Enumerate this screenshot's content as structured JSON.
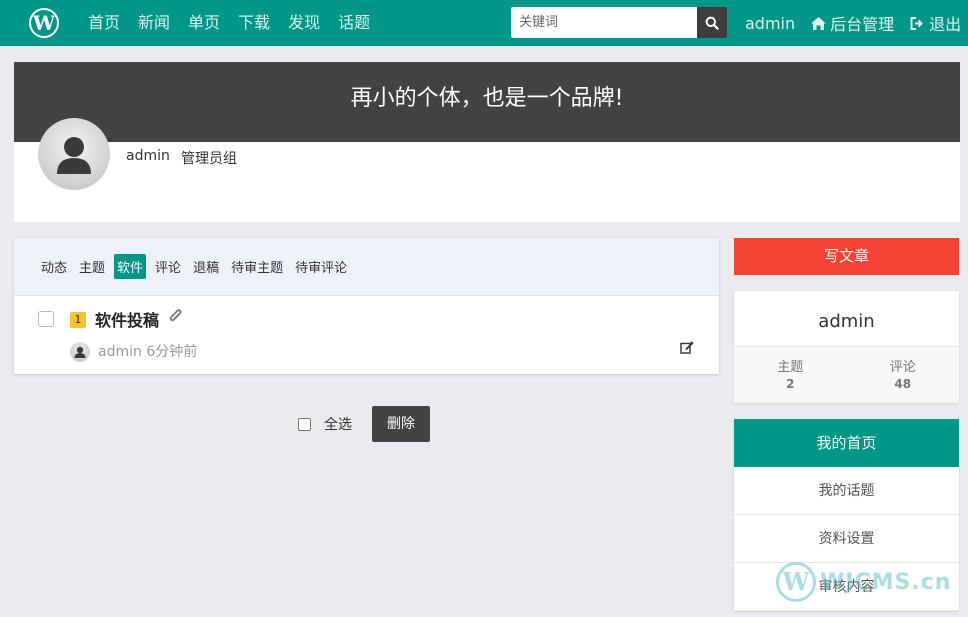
{
  "nav": {
    "logo_letter": "W",
    "links": [
      "首页",
      "新闻",
      "单页",
      "下载",
      "发现",
      "话题"
    ],
    "search_placeholder": "关键词",
    "user": "admin",
    "admin_label": "后台管理",
    "logout_label": "退出"
  },
  "profile": {
    "slogan": "再小的个体，也是一个品牌!",
    "username": "admin",
    "group": "管理员组"
  },
  "tabs": {
    "items": [
      "动态",
      "主题",
      "软件",
      "评论",
      "退稿",
      "待审主题",
      "待审评论"
    ],
    "active": "软件"
  },
  "post": {
    "number": "1",
    "title": "软件投稿",
    "author": "admin",
    "time": "6分钟前"
  },
  "bulk": {
    "select_all": "全选",
    "delete": "删除"
  },
  "sidebar": {
    "write_button": "写文章",
    "user_name": "admin",
    "stats": [
      {
        "label": "主题",
        "value": "2"
      },
      {
        "label": "评论",
        "value": "48"
      }
    ],
    "menu_head": "我的首页",
    "menu_items": [
      "我的话题",
      "资料设置",
      "审核内容"
    ]
  },
  "watermark": {
    "letter": "W",
    "text": "WJCMS.cn"
  },
  "colors": {
    "primary": "#009688",
    "banner": "#424242",
    "danger": "#f44336",
    "badge": "#f7c52b"
  }
}
